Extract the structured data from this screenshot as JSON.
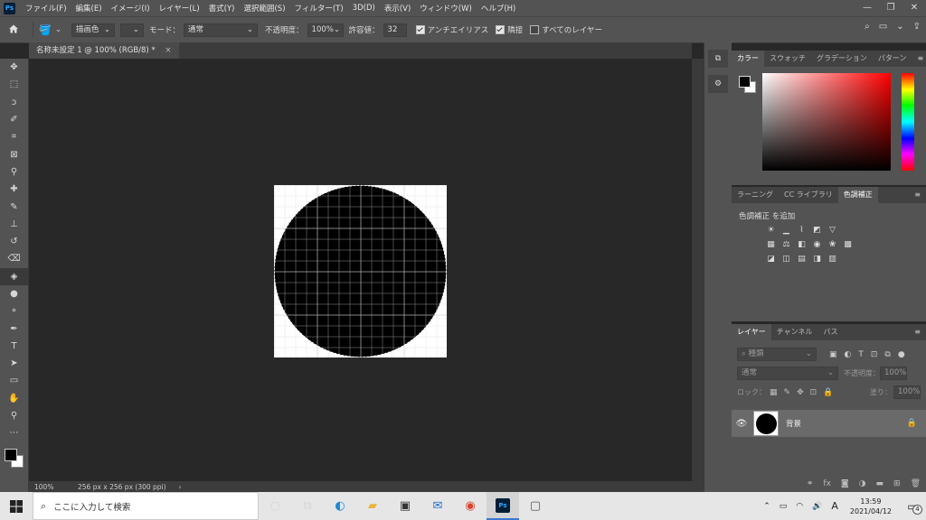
{
  "app": {
    "logo": "Ps",
    "menu": [
      "ファイル(F)",
      "編集(E)",
      "イメージ(I)",
      "レイヤー(L)",
      "書式(Y)",
      "選択範囲(S)",
      "フィルター(T)",
      "3D(D)",
      "表示(V)",
      "ウィンドウ(W)",
      "ヘルプ(H)"
    ],
    "window_controls": [
      "—",
      "❐",
      "✕"
    ]
  },
  "options_bar": {
    "fill_source": "描画色",
    "mode_label": "モード：",
    "mode_value": "通常",
    "opacity_label": "不透明度：",
    "opacity_value": "100%",
    "tolerance_label": "許容値：",
    "tolerance_value": "32",
    "antialias_label": "アンチエイリアス",
    "antialias_checked": true,
    "contiguous_label": "隣接",
    "contiguous_checked": true,
    "all_layers_label": "すべてのレイヤー",
    "all_layers_checked": false
  },
  "document": {
    "tab_title": "名称未設定 1 @ 100% (RGB/8) *",
    "tab_close": "×",
    "zoom": "100%",
    "doc_info": "256 px x 256 px (300 ppi)",
    "status_arrow": "›"
  },
  "toolbar": {
    "tools": [
      "move-icon",
      "marquee-icon",
      "lasso-icon",
      "quick-select-icon",
      "crop-icon",
      "frame-icon",
      "eyedropper-icon",
      "healing-icon",
      "brush-icon",
      "stamp-icon",
      "history-brush-icon",
      "eraser-icon",
      "paint-bucket-icon",
      "blur-icon",
      "dodge-icon",
      "pen-icon",
      "type-icon",
      "path-select-icon",
      "rectangle-icon",
      "hand-icon",
      "zoom-icon",
      "more-icon"
    ],
    "active": "paint-bucket-icon"
  },
  "color_panel": {
    "tabs": [
      "カラー",
      "スウォッチ",
      "グラデーション",
      "パターン"
    ],
    "active_tab": "カラー",
    "foreground": "#000000",
    "background": "#ffffff",
    "hue_color": "#ff0000"
  },
  "adjustments_panel": {
    "tabs": [
      "ラーニング",
      "CC ライブラリ",
      "色調補正"
    ],
    "active_tab": "色調補正",
    "heading": "色調補正 を追加"
  },
  "layers_panel": {
    "tabs": [
      "レイヤー",
      "チャンネル",
      "パス"
    ],
    "active_tab": "レイヤー",
    "filter_placeholder": "種類",
    "blend_mode": "通常",
    "opacity_label": "不透明度：",
    "opacity_value": "100%",
    "lock_label": "ロック：",
    "fill_label": "塗り：",
    "fill_value": "100%",
    "layers": [
      {
        "name": "背景",
        "visible": true,
        "locked": true
      }
    ]
  },
  "taskbar": {
    "search_placeholder": "ここに入力して検索",
    "time": "13:59",
    "date": "2021/04/12",
    "ime": "A",
    "notification_count": "4"
  }
}
